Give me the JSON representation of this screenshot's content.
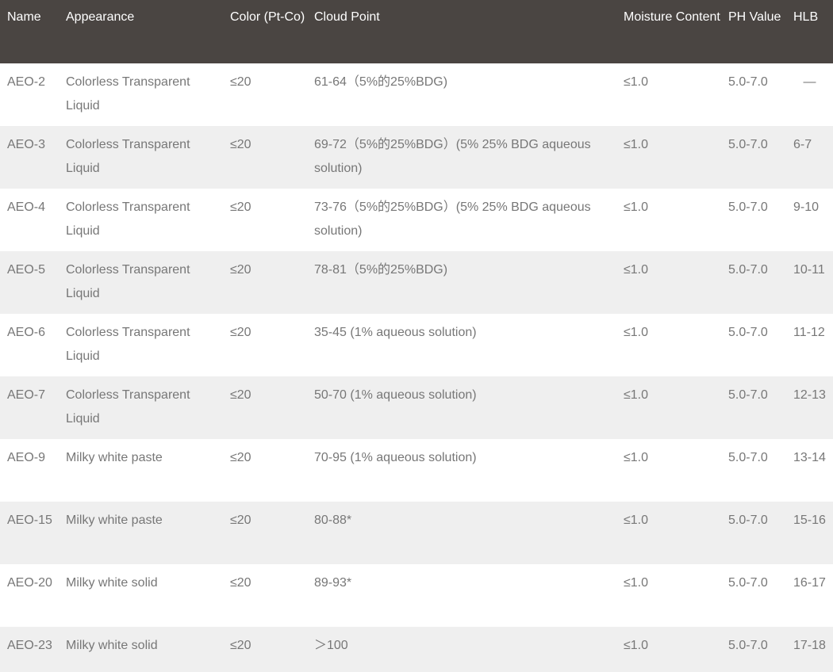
{
  "headers": {
    "name": "Name",
    "appearance": "Appearance",
    "color": "Color (Pt-Co)",
    "cloud_point": "Cloud Point",
    "moisture": "Moisture Content",
    "ph": "PH Value",
    "hlb": "HLB"
  },
  "rows": [
    {
      "name": "AEO-2",
      "appearance": "Colorless Transparent Liquid",
      "color": "≤20",
      "cloud_point": "61-64（5%的25%BDG)",
      "moisture": "≤1.0",
      "ph": "5.0-7.0",
      "hlb": "—"
    },
    {
      "name": "AEO-3",
      "appearance": "Colorless Transparent Liquid",
      "color": "≤20",
      "cloud_point": "69-72（5%的25%BDG）(5% 25% BDG aqueous solution)",
      "moisture": "≤1.0",
      "ph": "5.0-7.0",
      "hlb": "6-7"
    },
    {
      "name": "AEO-4",
      "appearance": "Colorless Transparent Liquid",
      "color": "≤20",
      "cloud_point": "73-76（5%的25%BDG）(5% 25% BDG aqueous solution)",
      "moisture": "≤1.0",
      "ph": "5.0-7.0",
      "hlb": "9-10"
    },
    {
      "name": "AEO-5",
      "appearance": "Colorless Transparent Liquid",
      "color": "≤20",
      "cloud_point": "78-81（5%的25%BDG)",
      "moisture": "≤1.0",
      "ph": "5.0-7.0",
      "hlb": "10-11"
    },
    {
      "name": "AEO-6",
      "appearance": "Colorless Transparent Liquid",
      "color": "≤20",
      "cloud_point": "35-45 (1% aqueous solution)",
      "moisture": "≤1.0",
      "ph": "5.0-7.0",
      "hlb": "11-12"
    },
    {
      "name": "AEO-7",
      "appearance": "Colorless Transparent Liquid",
      "color": "≤20",
      "cloud_point": "50-70 (1% aqueous solution)",
      "moisture": "≤1.0",
      "ph": "5.0-7.0",
      "hlb": "12-13"
    },
    {
      "name": "AEO-9",
      "appearance": "Milky white paste",
      "color": "≤20",
      "cloud_point": "70-95 (1% aqueous solution)",
      "moisture": "≤1.0",
      "ph": "5.0-7.0",
      "hlb": "13-14"
    },
    {
      "name": "AEO-15",
      "appearance": "Milky white  paste",
      "color": "≤20",
      "cloud_point": "80-88*",
      "moisture": "≤1.0",
      "ph": "5.0-7.0",
      "hlb": "15-16"
    },
    {
      "name": "AEO-20",
      "appearance": "Milky white solid",
      "color": "≤20",
      "cloud_point": "89-93*",
      "moisture": "≤1.0",
      "ph": "5.0-7.0",
      "hlb": "16-17"
    },
    {
      "name": "AEO-23",
      "appearance": "Milky white  solid",
      "color": "≤20",
      "cloud_point": "＞100",
      "moisture": "≤1.0",
      "ph": "5.0-7.0",
      "hlb": "17-18"
    }
  ]
}
